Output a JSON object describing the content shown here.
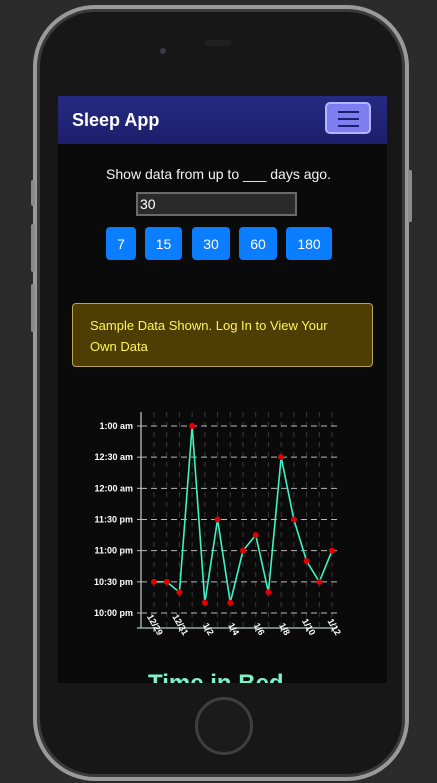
{
  "app": {
    "brand": "Sleep App",
    "menu_icon": "hamburger-icon"
  },
  "filter": {
    "prompt": "Show data from up to ___ days ago.",
    "days_value": "30",
    "buttons": [
      "7",
      "15",
      "30",
      "60",
      "180"
    ]
  },
  "alert": {
    "text": "Sample Data Shown. Log In to View Your Own Data"
  },
  "chart_data": {
    "type": "line",
    "title": "",
    "xlabel": "",
    "ylabel": "",
    "x": [
      "12/29",
      "12/30",
      "12/31",
      "1/1",
      "1/2",
      "1/3",
      "1/4",
      "1/5",
      "1/6",
      "1/7",
      "1/8",
      "1/9",
      "1/10",
      "1/11",
      "1/12"
    ],
    "x_tick_labels": [
      "12/29",
      "12/31",
      "1/2",
      "1/4",
      "1/6",
      "1/8",
      "1/10",
      "1/12"
    ],
    "y_tick_labels": [
      "10:00 pm",
      "10:30 pm",
      "11:00 pm",
      "11:30 pm",
      "12:00 am",
      "12:30 am",
      "1:00 am"
    ],
    "ylim": [
      "10:00 pm",
      "1:00 am"
    ],
    "series": [
      {
        "values": [
          "10:30 pm",
          "10:30 pm",
          "10:20 pm",
          "1:00 am",
          "10:10 pm",
          "11:30 pm",
          "10:10 pm",
          "11:00 pm",
          "11:15 pm",
          "10:20 pm",
          "12:30 am",
          "11:30 pm",
          "10:50 pm",
          "10:30 pm",
          "11:00 pm"
        ]
      }
    ],
    "grid": true,
    "line_color": "#3df2c4",
    "marker_color": "#e00000"
  },
  "below_chart_heading": "Time in Bed"
}
